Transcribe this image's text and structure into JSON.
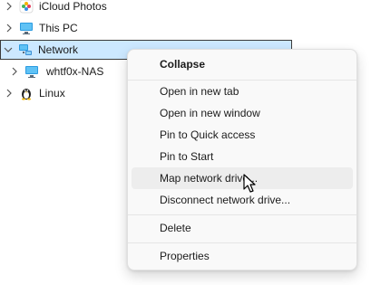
{
  "tree": {
    "items": [
      {
        "label": "iCloud Photos",
        "icon": "icloud-photos-icon"
      },
      {
        "label": "This PC",
        "icon": "this-pc-icon"
      },
      {
        "label": "Network",
        "icon": "network-icon"
      },
      {
        "label": "whtf0x-NAS",
        "icon": "computer-icon"
      },
      {
        "label": "Linux",
        "icon": "linux-penguin-icon"
      }
    ]
  },
  "context_menu": {
    "items": [
      {
        "label": "Collapse"
      },
      {
        "label": "Open in new tab"
      },
      {
        "label": "Open in new window"
      },
      {
        "label": "Pin to Quick access"
      },
      {
        "label": "Pin to Start"
      },
      {
        "label": "Map network drive..."
      },
      {
        "label": "Disconnect network drive..."
      },
      {
        "label": "Delete"
      },
      {
        "label": "Properties"
      }
    ]
  },
  "colors": {
    "selection": "#cce8ff",
    "menu_background": "#f9f9f9",
    "menu_hover": "#ededed"
  }
}
